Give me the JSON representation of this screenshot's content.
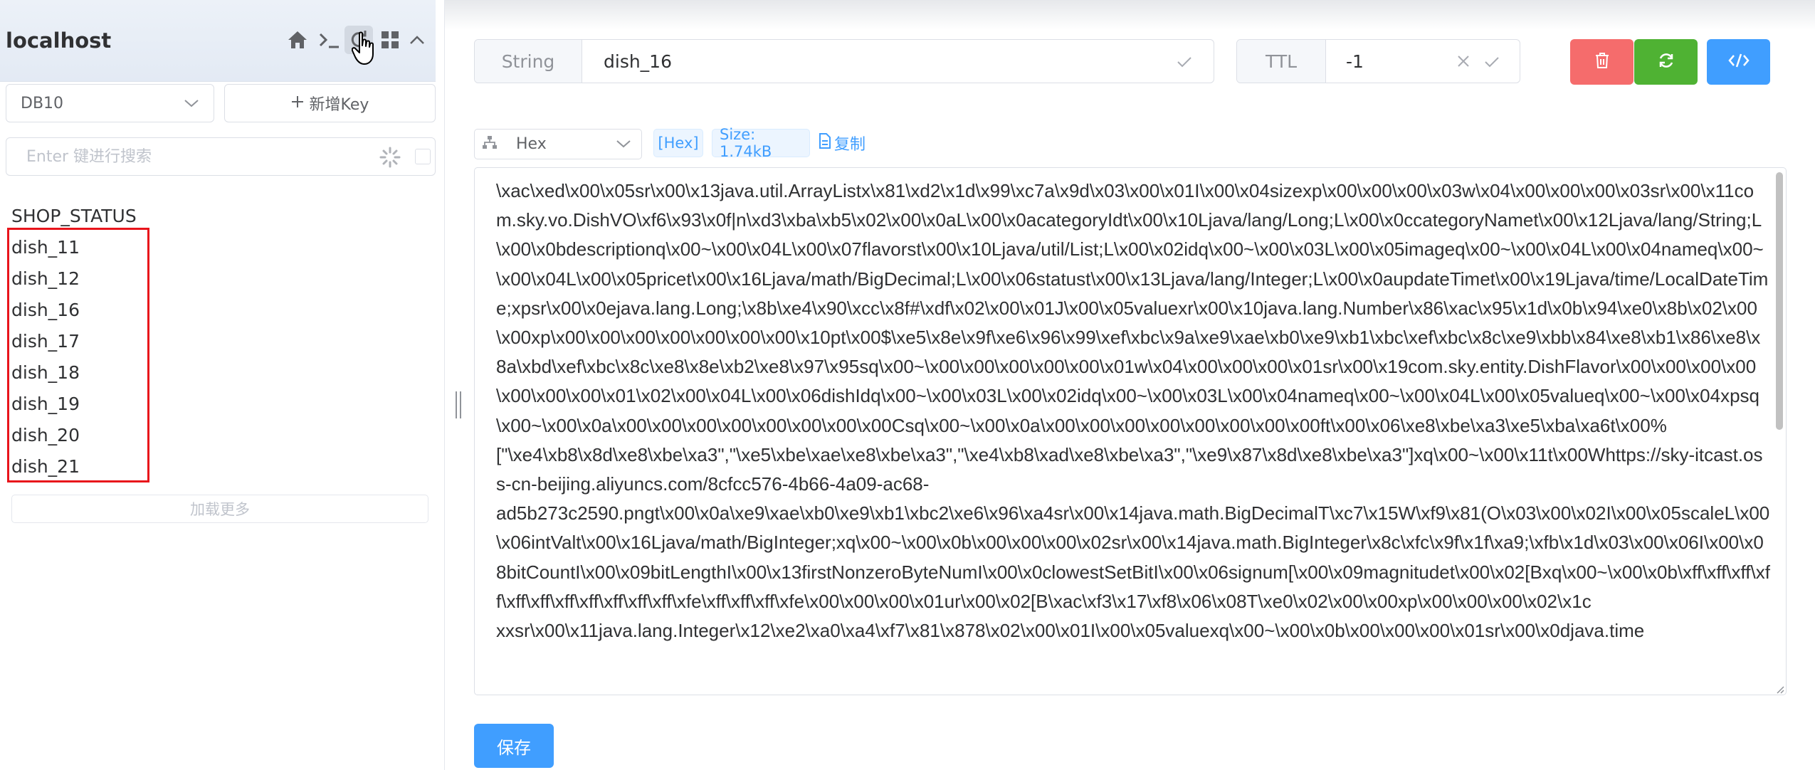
{
  "connection": {
    "name": "localhost"
  },
  "sidebar": {
    "db_selected": "DB10",
    "new_key_label": "新增Key",
    "search_placeholder": "Enter 键进行搜索",
    "keys": [
      "SHOP_STATUS",
      "dish_11",
      "dish_12",
      "dish_16",
      "dish_17",
      "dish_18",
      "dish_19",
      "dish_20",
      "dish_21"
    ],
    "load_more_label": "加载更多"
  },
  "editor": {
    "key_type": "String",
    "key_name": "dish_16",
    "ttl_label": "TTL",
    "ttl_value": "-1",
    "format": "Hex",
    "format_tag": "[Hex]",
    "size_tag": "Size: 1.74kB",
    "copy_label": "复制",
    "value_text": "\\xac\\xed\\x00\\x05sr\\x00\\x13java.util.ArrayListx\\x81\\xd2\\x1d\\x99\\xc7a\\x9d\\x03\\x00\\x01I\\x00\\x04sizexp\\x00\\x00\\x00\\x03w\\x04\\x00\\x00\\x00\\x03sr\\x00\\x11com.sky.vo.DishVO\\xf6\\x93\\x0f|n\\xd3\\xba\\xb5\\x02\\x00\\x0aL\\x00\\x0acategoryIdt\\x00\\x10Ljava/lang/Long;L\\x00\\x0ccategoryNamet\\x00\\x12Ljava/lang/String;L\\x00\\x0bdescriptionq\\x00~\\x00\\x04L\\x00\\x07flavorst\\x00\\x10Ljava/util/List;L\\x00\\x02idq\\x00~\\x00\\x03L\\x00\\x05imageq\\x00~\\x00\\x04L\\x00\\x04nameq\\x00~\\x00\\x04L\\x00\\x05pricet\\x00\\x16Ljava/math/BigDecimal;L\\x00\\x06statust\\x00\\x13Ljava/lang/Integer;L\\x00\\x0aupdateTimet\\x00\\x19Ljava/time/LocalDateTime;xpsr\\x00\\x0ejava.lang.Long;\\x8b\\xe4\\x90\\xcc\\x8f#\\xdf\\x02\\x00\\x01J\\x00\\x05valuexr\\x00\\x10java.lang.Number\\x86\\xac\\x95\\x1d\\x0b\\x94\\xe0\\x8b\\x02\\x00\\x00xp\\x00\\x00\\x00\\x00\\x00\\x00\\x00\\x10pt\\x00$\\xe5\\x8e\\x9f\\xe6\\x96\\x99\\xef\\xbc\\x9a\\xe9\\xae\\xb0\\xe9\\xb1\\xbc\\xef\\xbc\\x8c\\xe9\\xbb\\x84\\xe8\\xb1\\x86\\xe8\\x8a\\xbd\\xef\\xbc\\x8c\\xe8\\x8e\\xb2\\xe8\\x97\\x95sq\\x00~\\x00\\x00\\x00\\x00\\x00\\x01w\\x04\\x00\\x00\\x00\\x01sr\\x00\\x19com.sky.entity.DishFlavor\\x00\\x00\\x00\\x00\\x00\\x00\\x00\\x01\\x02\\x00\\x04L\\x00\\x06dishIdq\\x00~\\x00\\x03L\\x00\\x02idq\\x00~\\x00\\x03L\\x00\\x04nameq\\x00~\\x00\\x04L\\x00\\x05valueq\\x00~\\x00\\x04xpsq\\x00~\\x00\\x0a\\x00\\x00\\x00\\x00\\x00\\x00\\x00\\x00Csq\\x00~\\x00\\x0a\\x00\\x00\\x00\\x00\\x00\\x00\\x00\\x00ft\\x00\\x06\\xe8\\xbe\\xa3\\xe5\\xba\\xa6t\\x00%\n[\"\\xe4\\xb8\\x8d\\xe8\\xbe\\xa3\",\"\\xe5\\xbe\\xae\\xe8\\xbe\\xa3\",\"\\xe4\\xb8\\xad\\xe8\\xbe\\xa3\",\"\\xe9\\x87\\x8d\\xe8\\xbe\\xa3\"]xq\\x00~\\x00\\x11t\\x00Whttps://sky-itcast.oss-cn-beijing.aliyuncs.com/8cfcc576-4b66-4a09-ac68-\nad5b273c2590.pngt\\x00\\x0a\\xe9\\xae\\xb0\\xe9\\xb1\\xbc2\\xe6\\x96\\xa4sr\\x00\\x14java.math.BigDecimalT\\xc7\\x15W\\xf9\\x81(O\\x03\\x00\\x02I\\x00\\x05scaleL\\x00\\x06intValt\\x00\\x16Ljava/math/BigInteger;xq\\x00~\\x00\\x0b\\x00\\x00\\x00\\x02sr\\x00\\x14java.math.BigInteger\\x8c\\xfc\\x9f\\x1f\\xa9;\\xfb\\x1d\\x03\\x00\\x06I\\x00\\x08bitCountI\\x00\\x09bitLengthI\\x00\\x13firstNonzeroByteNumI\\x00\\x0clowestSetBitI\\x00\\x06signum[\\x00\\x09magnitudet\\x00\\x02[Bxq\\x00~\\x00\\x0b\\xff\\xff\\xff\\xff\\xff\\xff\\xff\\xff\\xff\\xff\\xff\\xfe\\xff\\xff\\xff\\xfe\\x00\\x00\\x00\\x01ur\\x00\\x02[B\\xac\\xf3\\x17\\xf8\\x06\\x08T\\xe0\\x02\\x00\\x00xp\\x00\\x00\\x00\\x02\\x1c\nxxsr\\x00\\x11java.lang.Integer\\x12\\xe2\\xa0\\xa4\\xf7\\x81\\x878\\x02\\x00\\x01I\\x00\\x05valuexq\\x00~\\x00\\x0b\\x00\\x00\\x00\\x01sr\\x00\\x0djava.time",
    "save_label": "保存"
  },
  "colors": {
    "danger": "#f56c6c",
    "success": "#4fb233",
    "primary": "#409eff",
    "highlight": "#e8141b"
  },
  "icons": {
    "header": [
      "home-icon",
      "terminal-icon",
      "refresh-icon",
      "grid-icon",
      "chevron-up-icon"
    ],
    "actions": [
      "trash-icon",
      "refresh-icon",
      "code-icon"
    ]
  }
}
